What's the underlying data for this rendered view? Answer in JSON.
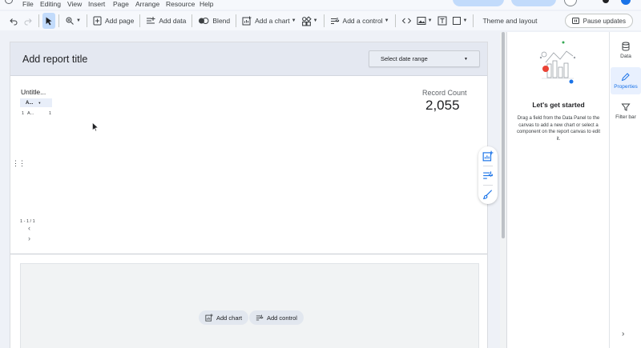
{
  "menu": {
    "items": [
      "File",
      "Editing",
      "View",
      "Insert",
      "Page",
      "Arrange",
      "Resource",
      "Help"
    ]
  },
  "toolbar": {
    "add_page": "Add page",
    "add_data": "Add data",
    "blend": "Blend",
    "add_chart": "Add a chart",
    "add_control": "Add a control",
    "theme_layout": "Theme and layout",
    "pause_updates": "Pause updates"
  },
  "report": {
    "title": "Add report title",
    "date_range": "Select date range"
  },
  "table": {
    "title": "Untitle...",
    "column": "A...",
    "row_index": "1",
    "row_value": "A...",
    "row_count": "1",
    "pagination": "1 - 1 / 1"
  },
  "scorecard": {
    "label": "Record Count",
    "value": "2,055"
  },
  "empty_page": {
    "add_chart": "Add chart",
    "add_control": "Add control"
  },
  "panel": {
    "title": "Let's get started",
    "description": "Drag a field from the Data Panel to the canvas to add a new chart or select a component on the report canvas to edit it."
  },
  "rail": {
    "data": "Data",
    "properties": "Properties",
    "filter_bar": "Filter bar"
  },
  "icons": {
    "undo": "undo-icon",
    "redo": "redo-icon",
    "select": "cursor-icon",
    "zoom": "zoom-icon",
    "add_page": "add-page-icon",
    "add_data": "add-data-icon",
    "blend": "blend-icon",
    "chart": "chart-icon",
    "community": "community-viz-icon",
    "control": "control-icon",
    "embed": "code-icon",
    "image": "image-icon",
    "text": "text-icon",
    "shape": "shape-icon",
    "pause": "pause-icon"
  },
  "colors": {
    "accent": "#1a73e8",
    "active_tool": "#c2dbfb",
    "header_band": "#e4e8f1"
  }
}
